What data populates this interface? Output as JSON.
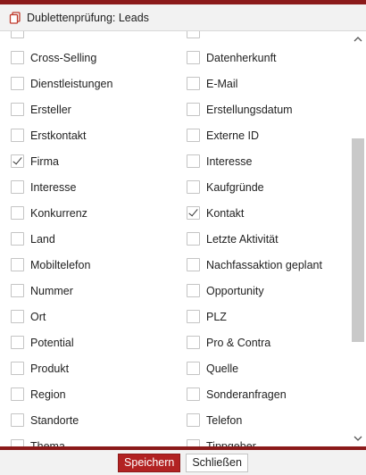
{
  "window": {
    "title": "Dublettenprüfung: Leads",
    "icon": "copy-document-icon",
    "accent": "#8b1a1a"
  },
  "fields": {
    "left": [
      {
        "label": "",
        "checked": false
      },
      {
        "label": "Cross-Selling",
        "checked": false
      },
      {
        "label": "Dienstleistungen",
        "checked": false
      },
      {
        "label": "Ersteller",
        "checked": false
      },
      {
        "label": "Erstkontakt",
        "checked": false
      },
      {
        "label": "Firma",
        "checked": true
      },
      {
        "label": "Interesse",
        "checked": false
      },
      {
        "label": "Konkurrenz",
        "checked": false
      },
      {
        "label": "Land",
        "checked": false
      },
      {
        "label": "Mobiltelefon",
        "checked": false
      },
      {
        "label": "Nummer",
        "checked": false
      },
      {
        "label": "Ort",
        "checked": false
      },
      {
        "label": "Potential",
        "checked": false
      },
      {
        "label": "Produkt",
        "checked": false
      },
      {
        "label": "Region",
        "checked": false
      },
      {
        "label": "Standorte",
        "checked": false
      },
      {
        "label": "Thema",
        "checked": false
      }
    ],
    "right": [
      {
        "label": "",
        "checked": false
      },
      {
        "label": "Datenherkunft",
        "checked": false
      },
      {
        "label": "E-Mail",
        "checked": false
      },
      {
        "label": "Erstellungsdatum",
        "checked": false
      },
      {
        "label": "Externe ID",
        "checked": false
      },
      {
        "label": "Interesse",
        "checked": false
      },
      {
        "label": "Kaufgründe",
        "checked": false
      },
      {
        "label": "Kontakt",
        "checked": true
      },
      {
        "label": "Letzte Aktivität",
        "checked": false
      },
      {
        "label": "Nachfassaktion geplant",
        "checked": false
      },
      {
        "label": "Opportunity",
        "checked": false
      },
      {
        "label": "PLZ",
        "checked": false
      },
      {
        "label": "Pro & Contra",
        "checked": false
      },
      {
        "label": "Quelle",
        "checked": false
      },
      {
        "label": "Sonderanfragen",
        "checked": false
      },
      {
        "label": "Telefon",
        "checked": false
      },
      {
        "label": "Tippgeber",
        "checked": false
      }
    ]
  },
  "footer": {
    "save_label": "Speichern",
    "close_label": "Schließen"
  }
}
